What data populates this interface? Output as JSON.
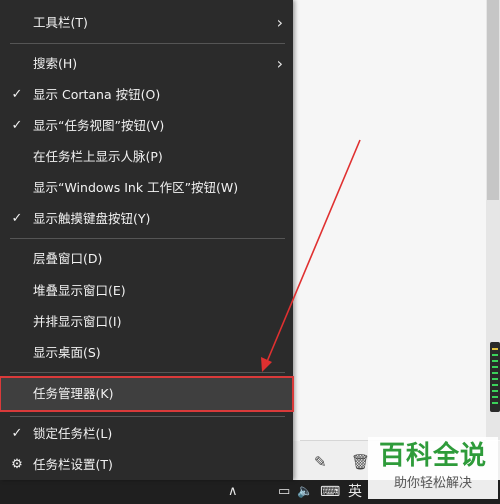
{
  "menu": {
    "items": [
      {
        "label": "工具栏(T)",
        "checked": false,
        "submenu": true
      },
      {
        "label": "搜索(H)",
        "checked": false,
        "submenu": true
      },
      {
        "label": "显示 Cortana 按钮(O)",
        "checked": true,
        "submenu": false
      },
      {
        "label": "显示“任务视图”按钮(V)",
        "checked": true,
        "submenu": false
      },
      {
        "label": "在任务栏上显示人脉(P)",
        "checked": false,
        "submenu": false
      },
      {
        "label": "显示“Windows Ink 工作区”按钮(W)",
        "checked": false,
        "submenu": false
      },
      {
        "label": "显示触摸键盘按钮(Y)",
        "checked": true,
        "submenu": false
      },
      {
        "label": "层叠窗口(D)",
        "checked": false,
        "submenu": false
      },
      {
        "label": "堆叠显示窗口(E)",
        "checked": false,
        "submenu": false
      },
      {
        "label": "并排显示窗口(I)",
        "checked": false,
        "submenu": false
      },
      {
        "label": "显示桌面(S)",
        "checked": false,
        "submenu": false
      },
      {
        "label": "任务管理器(K)",
        "checked": false,
        "submenu": false,
        "highlighted": true
      },
      {
        "label": "锁定任务栏(L)",
        "checked": true,
        "submenu": false
      },
      {
        "label": "任务栏设置(T)",
        "checked": false,
        "submenu": false,
        "icon": "gear-icon"
      }
    ],
    "check_glyph": "✓",
    "arrow_glyph": "›",
    "gear_glyph": "⚙"
  },
  "tray": {
    "language": "英",
    "icons": [
      "chevron-up-icon",
      "volume-icon",
      "keyboard-icon",
      "action-center-icon"
    ]
  },
  "watermark": {
    "logo": "百科全说",
    "subtitle": "助你轻松解决"
  },
  "colors": {
    "menu_bg": "#2b2b2b",
    "menu_text": "#f2f2f2",
    "highlight_border": "#d93a3a",
    "annotation_arrow": "#e03030",
    "watermark_green": "#2e9b3a"
  }
}
